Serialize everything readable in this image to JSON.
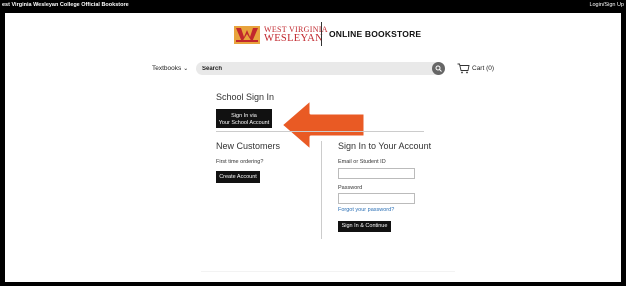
{
  "topbar": {
    "site_name": "est Virginia Wesleyan College Official Bookstore",
    "login_link": "Login/Sign Up"
  },
  "header": {
    "logo_line1": "WEST VIRGINIA",
    "logo_line2": "WESLEYAN",
    "store_title": "ONLINE BOOKSTORE"
  },
  "nav": {
    "textbooks_label": "Textbooks",
    "search_placeholder": "Search",
    "cart_label": "Cart (0)"
  },
  "school_signin": {
    "heading": "School Sign In",
    "button_line1": "Sign In via",
    "button_line2": "Your School Account"
  },
  "new_customers": {
    "heading": "New Customers",
    "subtext": "First time ordering?",
    "button_label": "Create Account"
  },
  "signin": {
    "heading": "Sign In to Your Account",
    "email_label": "Email or Student ID",
    "email_value": "",
    "password_label": "Password",
    "password_value": "",
    "forgot_link": "Forgot your password?",
    "submit_label": "Sign In & Continue"
  },
  "colors": {
    "brand_red": "#c1272d",
    "logo_gold": "#e8a33d",
    "arrow_orange": "#e95a24",
    "link_blue": "#2a6fb5"
  }
}
